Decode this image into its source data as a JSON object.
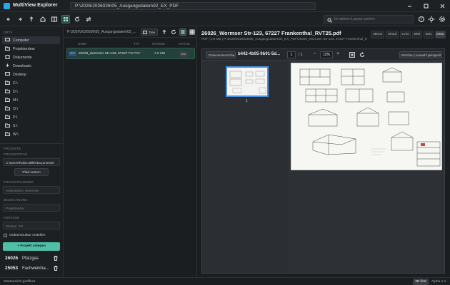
{
  "app": {
    "title": "MultiView Explorer",
    "path": "P:\\2026\\2026026\\05_Ausgangsdaten\\02_EX_PDF"
  },
  "toolbar": {
    "layout_search_placeholder": "Im aktiven Layout suchen"
  },
  "sidebar": {
    "section_title": "ORTE",
    "items": [
      {
        "label": "Computer",
        "icon": "computer-icon"
      },
      {
        "label": "Projektordner",
        "icon": "folder-icon"
      },
      {
        "label": "Dokumente",
        "icon": "document-icon"
      },
      {
        "label": "Downloads",
        "icon": "download-icon"
      },
      {
        "label": "Desktop",
        "icon": "desktop-icon"
      },
      {
        "label": "C:\\",
        "icon": "folder-icon"
      },
      {
        "label": "D:\\",
        "icon": "folder-icon"
      },
      {
        "label": "M:\\",
        "icon": "folder-icon"
      },
      {
        "label": "O:\\",
        "icon": "folder-icon"
      },
      {
        "label": "P:\\",
        "icon": "folder-icon"
      },
      {
        "label": "S:\\",
        "icon": "folder-icon"
      },
      {
        "label": "W:\\",
        "icon": "folder-icon"
      }
    ],
    "projects": {
      "section_title": "PROJEKTE",
      "path_label": "PROJEKTPFAD",
      "path_value": "C:\\Users\\Robin.Miller\\Documents\\",
      "set_path_button": "Pfad setzen",
      "number_label": "PROJEKTNUMMER",
      "number_placeholder": "Automatisch, wenn leer",
      "name_label": "BEZEICHNUNG",
      "name_placeholder": "Projektname",
      "address_label": "ADRESSE",
      "address_placeholder": "Strasse, Ort",
      "structure_checkbox": "Ordnerstruktur erstellen",
      "create_button": "Projekt anlegen",
      "list": [
        {
          "number": "26026",
          "name": "Pfalzgas"
        },
        {
          "number": "25053",
          "name": "Fachwerkha..."
        }
      ]
    }
  },
  "file_panel": {
    "path": "P:\\2026\\2026026\\05_Ausgangsdaten\\02_...",
    "tree_button": "Tree",
    "columns": [
      "NAME",
      "TYP",
      "GRÖSSE",
      "STATUS"
    ],
    "files": [
      {
        "badge": "DOC",
        "name": "26026_Wormser Str-123, 67227 Frankenthal_RVT25.pdf",
        "type": "PDF",
        "size": "3.8 MB",
        "status": "Doc"
      }
    ]
  },
  "preview": {
    "title": "26026_Wormser Str-123, 67227 Frankenthal_RVT25.pdf",
    "meta": "PDF | 3.8 MB | P:\\2026\\2026026\\05_Ausgangsdaten\\02_EX_PDF\\26026_Wormser Str-123, 67227 Frankenthal_RVT25.pdf",
    "view_tabs": [
      "3DGS",
      "Cloud",
      "CAD",
      "BIM",
      "IMG",
      "DOC"
    ],
    "active_tab": "DOC",
    "viewer": {
      "doc_pill": "Dokumentvorschau",
      "doc_id": "b442-4b05-9b91-5d...",
      "page": "1",
      "page_total": "/ 1",
      "zoom": "12%",
      "zoom_out": "−",
      "zoom_in": "+",
      "note": "Vorschau | Auswahl gekoppelt",
      "thumb_page": "1"
    }
  },
  "statusbar": {
    "text": "Startansicht geöffnet.",
    "mode": "3D-first",
    "version": "Alpha 1.1"
  },
  "colors": {
    "accent": "#4fbfa8",
    "selection": "#234039",
    "background": "#1b1e21"
  }
}
